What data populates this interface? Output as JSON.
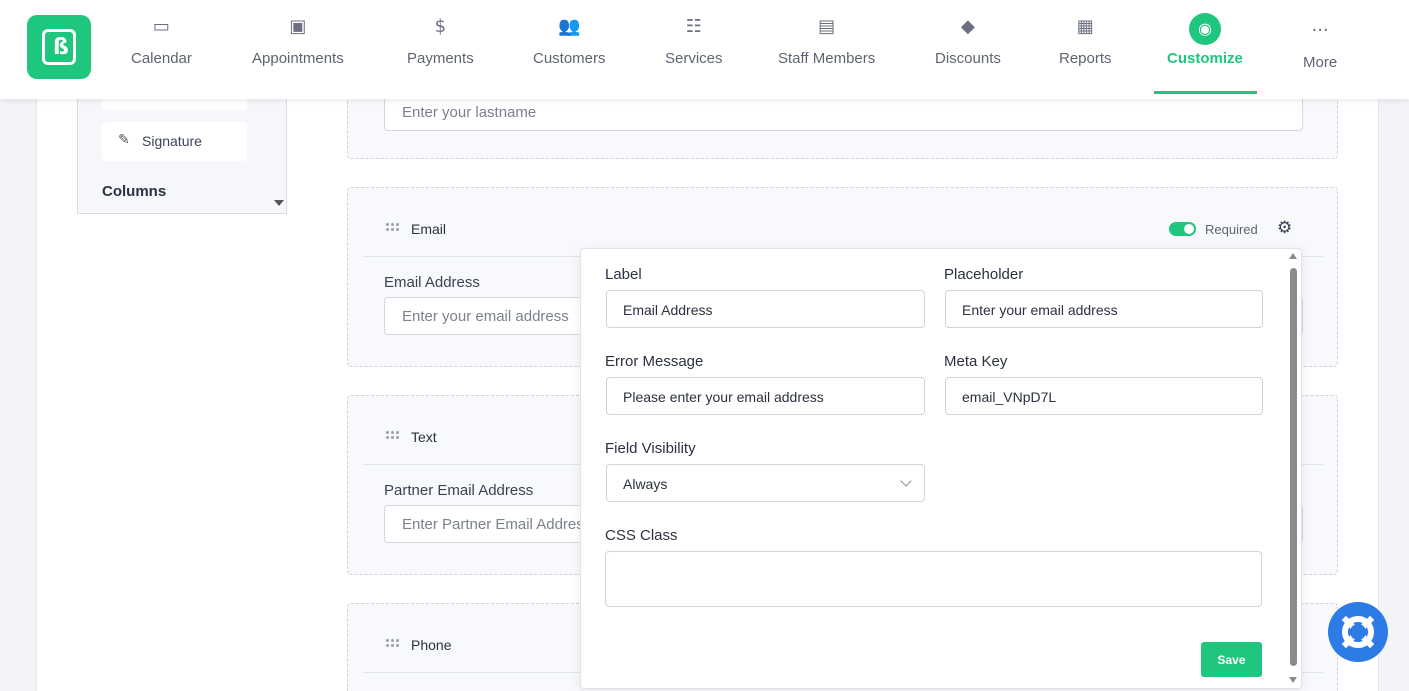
{
  "nav": {
    "items": [
      {
        "label": "Calendar",
        "icon": "calendar-icon",
        "glyph": "▭"
      },
      {
        "label": "Appointments",
        "icon": "calendar-check-icon",
        "glyph": "▣"
      },
      {
        "label": "Payments",
        "icon": "dollar-icon",
        "glyph": "$"
      },
      {
        "label": "Customers",
        "icon": "users-icon",
        "glyph": "👥"
      },
      {
        "label": "Services",
        "icon": "list-icon",
        "glyph": "☷"
      },
      {
        "label": "Staff Members",
        "icon": "id-badge-icon",
        "glyph": "▤"
      },
      {
        "label": "Discounts",
        "icon": "tag-icon",
        "glyph": "◆"
      },
      {
        "label": "Reports",
        "icon": "report-icon",
        "glyph": "▦"
      },
      {
        "label": "Customize",
        "icon": "palette-icon",
        "glyph": "◉"
      },
      {
        "label": "More",
        "icon": "more-icon",
        "glyph": "···"
      }
    ],
    "accent": "#1fc77e"
  },
  "palette": {
    "signature": "Signature",
    "columns_heading": "Columns"
  },
  "lastname_block": {
    "placeholder": "Enter your lastname"
  },
  "email_block": {
    "type": "Email",
    "required": "Required",
    "label": "Email Address",
    "placeholder": "Enter your email address"
  },
  "text_block": {
    "type": "Text",
    "label": "Partner Email Address",
    "placeholder": "Enter Partner Email Address"
  },
  "phone_block": {
    "type": "Phone"
  },
  "popover": {
    "label_label": "Label",
    "label_value": "Email Address",
    "placeholder_label": "Placeholder",
    "placeholder_value": "Enter your email address",
    "error_label": "Error Message",
    "error_value": "Please enter your email address",
    "meta_label": "Meta Key",
    "meta_value": "email_VNpD7L",
    "visibility_label": "Field Visibility",
    "visibility_value": "Always",
    "css_label": "CSS Class",
    "css_value": "",
    "save": "Save"
  }
}
